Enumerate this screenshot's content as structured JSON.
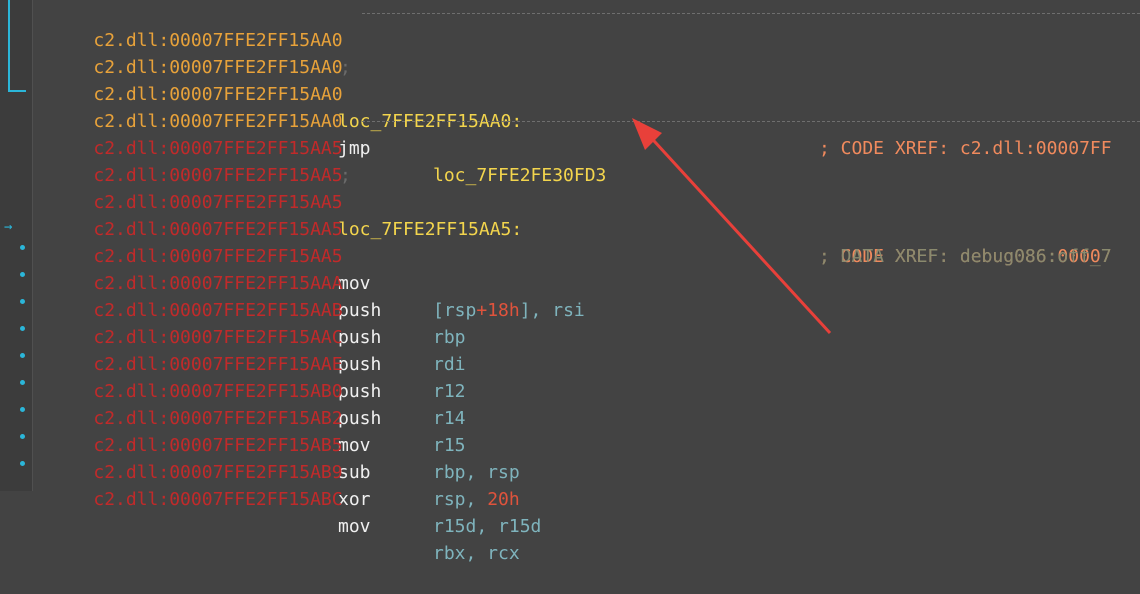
{
  "lines": [
    {
      "addr": "c2.dll:00007FFE2FF15AA0",
      "sep": ";"
    },
    {
      "addr": "c2.dll:00007FFE2FF15AA0"
    },
    {
      "addr": "c2.dll:00007FFE2FF15AA0",
      "label": "loc_7FFE2FF15AA0:",
      "comment": "; CODE XREF: c2.dll:00007FF"
    },
    {
      "addr": "c2.dll:00007FFE2FF15AA0",
      "mnem": "jmp",
      "target": "loc_7FFE2FE30FD3"
    },
    {
      "addr": "c2.dll:00007FFE2FF15AA5",
      "sep": ";"
    },
    {
      "addr": "c2.dll:00007FFE2FF15AA5"
    },
    {
      "addr": "c2.dll:00007FFE2FF15AA5",
      "label": "loc_7FFE2FF15AA5:",
      "comment": "; CODE XREF: debug086:00007"
    },
    {
      "addr": "c2.dll:00007FFE2FF15AA5",
      "comment": "; DATA XREF: debug086:off_7"
    },
    {
      "addr": "c2.dll:00007FFE2FF15AA5",
      "mnem": "mov",
      "op_open": "[rsp",
      "op_plus": "+",
      "op_num": "18h",
      "op_close": "], rsi"
    },
    {
      "addr": "c2.dll:00007FFE2FF15AAA",
      "mnem": "push",
      "op": "rbp"
    },
    {
      "addr": "c2.dll:00007FFE2FF15AAB",
      "mnem": "push",
      "op": "rdi"
    },
    {
      "addr": "c2.dll:00007FFE2FF15AAC",
      "mnem": "push",
      "op": "r12"
    },
    {
      "addr": "c2.dll:00007FFE2FF15AAE",
      "mnem": "push",
      "op": "r14"
    },
    {
      "addr": "c2.dll:00007FFE2FF15AB0",
      "mnem": "push",
      "op": "r15"
    },
    {
      "addr": "c2.dll:00007FFE2FF15AB2",
      "mnem": "mov",
      "op": "rbp, rsp"
    },
    {
      "addr": "c2.dll:00007FFE2FF15AB5",
      "mnem": "sub",
      "op": "rsp, ",
      "op_num": "20h"
    },
    {
      "addr": "c2.dll:00007FFE2FF15AB9",
      "mnem": "xor",
      "op": "r15d, r15d"
    },
    {
      "addr": "c2.dll:00007FFE2FF15ABC",
      "mnem": "mov",
      "op": "rbx, rcx"
    }
  ],
  "colors": {
    "background": "#434343",
    "address_orange": "#e8a23a",
    "address_red": "#c12a2a",
    "label_yellow": "#f3d54d",
    "register_teal": "#7fb4bd",
    "number_red": "#e0533c",
    "comment_orange": "#f08a5d",
    "annotation_arrow": "#e8403a",
    "flow_cyan": "#2bb6d9"
  }
}
